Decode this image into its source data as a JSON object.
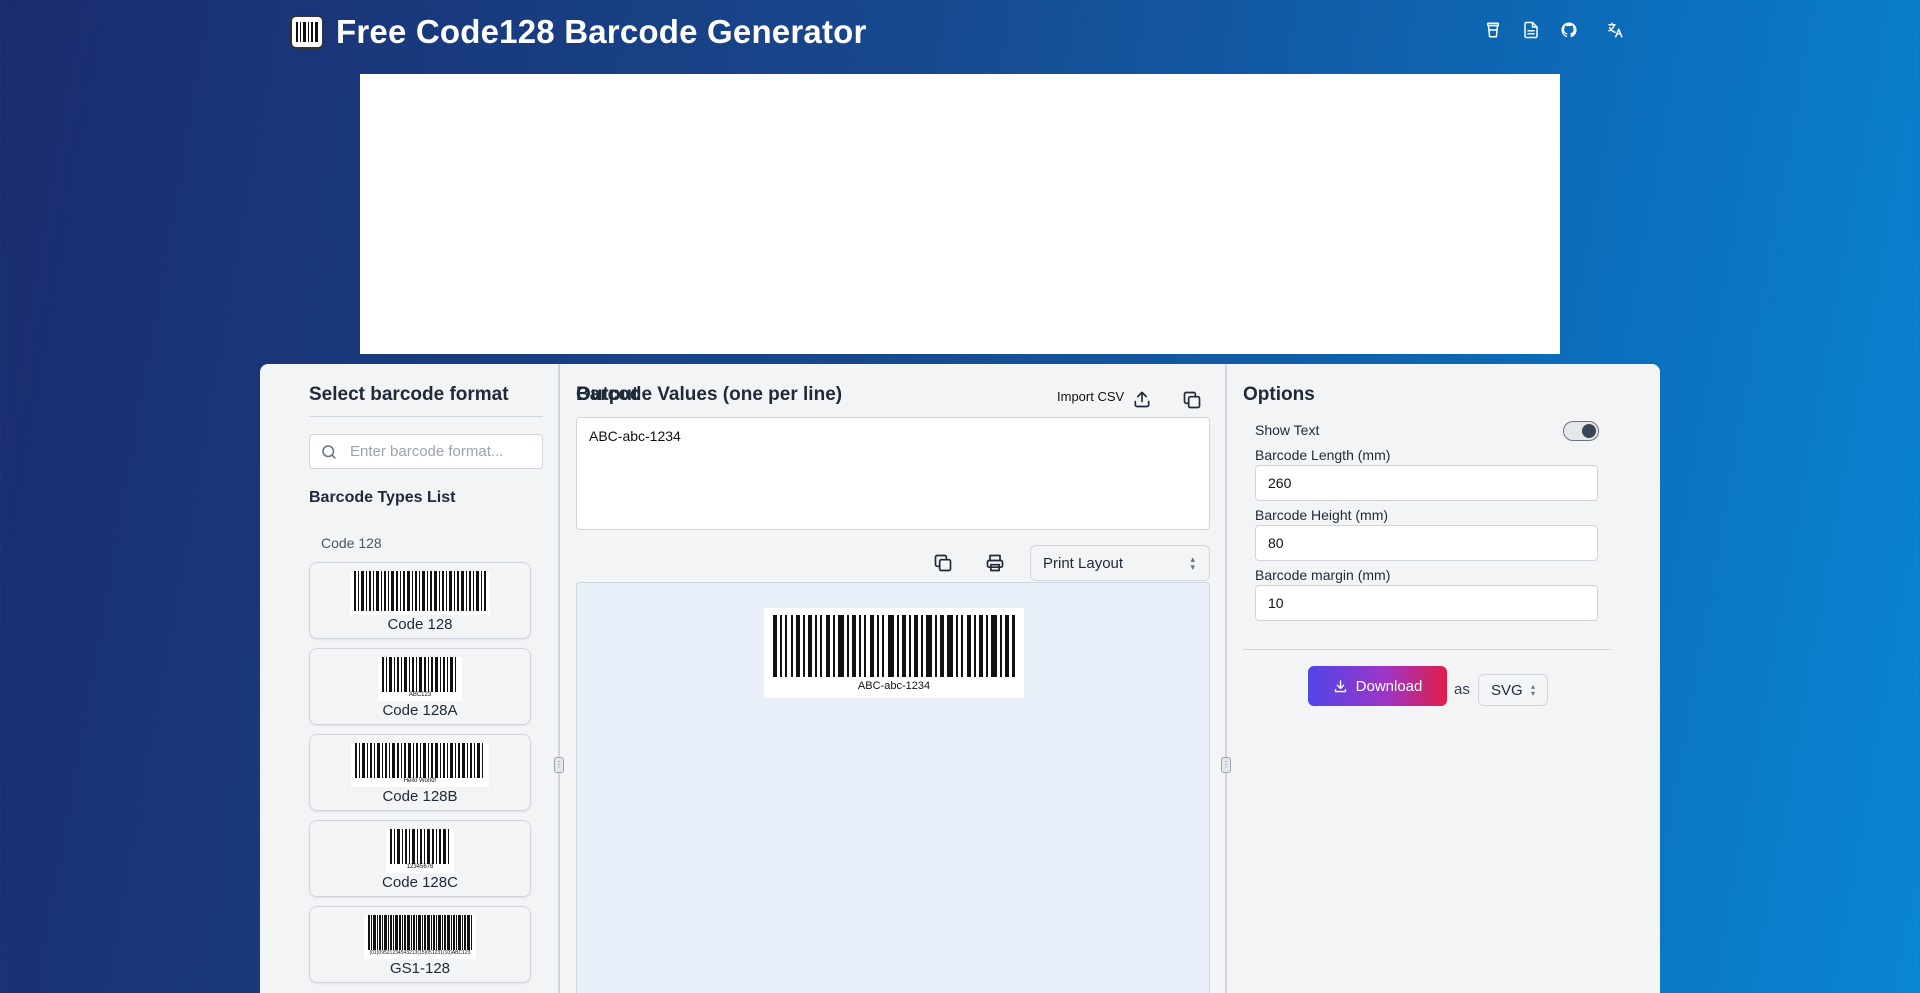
{
  "header": {
    "title": "Free Code128 Barcode Generator",
    "icons": [
      "coffee-icon",
      "document-icon",
      "github-icon",
      "translate-icon"
    ]
  },
  "left": {
    "title": "Select barcode format",
    "search_placeholder": "Enter barcode format...",
    "types_title": "Barcode Types List",
    "group_label": "Code 128",
    "types": [
      {
        "name": "Code 128",
        "sample": ""
      },
      {
        "name": "Code 128A",
        "sample": "ABC123"
      },
      {
        "name": "Code 128B",
        "sample": "Hello World!"
      },
      {
        "name": "Code 128C",
        "sample": "12345678"
      },
      {
        "name": "GS1-128",
        "sample": "(01)09521234543213(15)051231(10)ABC123"
      }
    ]
  },
  "middle": {
    "values_title": "Barcode Values (one per line)",
    "import_csv_label": "Import CSV",
    "values_text": "ABC-abc-1234",
    "output_title": "Output",
    "layout_select": "Print Layout",
    "output_barcode_label": "ABC-abc-1234"
  },
  "right": {
    "title": "Options",
    "show_text_label": "Show Text",
    "show_text_enabled": true,
    "length_label": "Barcode Length (mm)",
    "length_value": "260",
    "height_label": "Barcode Height (mm)",
    "height_value": "80",
    "margin_label": "Barcode margin (mm)",
    "margin_value": "10",
    "download_label": "Download",
    "as_label": "as",
    "format_value": "SVG"
  },
  "colors": {
    "bg_start": "#1b2c6e",
    "bg_end": "#0a86d4",
    "panel": "#f3f4f6",
    "download_gradient": [
      "#4f46e5",
      "#e11d48"
    ]
  }
}
